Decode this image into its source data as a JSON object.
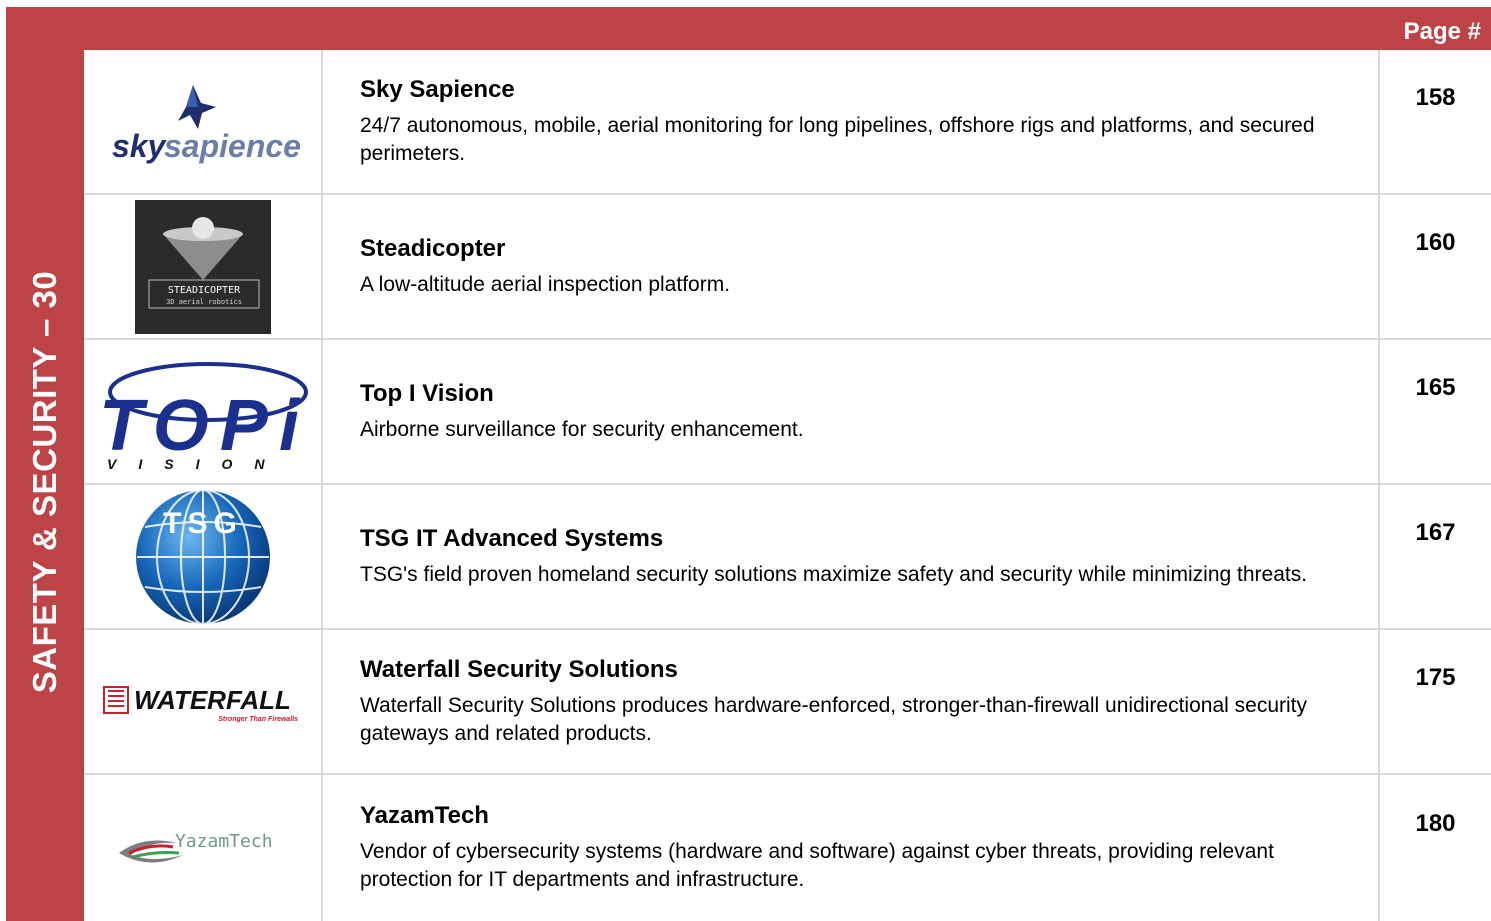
{
  "side_label": "SAFETY & SECURITY – 30",
  "page_header": "Page #",
  "rows": [
    {
      "name": "Sky Sapience",
      "description": "24/7 autonomous, mobile, aerial monitoring for long pipelines, offshore rigs and platforms, and secured perimeters.",
      "page": "158",
      "logo": {
        "icon": "skysapience-logo",
        "text_a": "sky",
        "text_b": "sapience"
      }
    },
    {
      "name": "Steadicopter",
      "description": "A low-altitude aerial inspection platform.",
      "page": "160",
      "logo": {
        "icon": "steadicopter-logo",
        "line1": "STEADICOPTER",
        "line2": "3D aerial robotics"
      }
    },
    {
      "name": "Top I Vision",
      "description": "Airborne surveillance for security enhancement.",
      "page": "165",
      "logo": {
        "icon": "topivision-logo",
        "line1": "TOPi",
        "line2": "VISION"
      }
    },
    {
      "name": "TSG IT Advanced Systems",
      "description": "TSG's field proven homeland security solutions maximize safety and security while minimizing threats.",
      "page": "167",
      "logo": {
        "icon": "tsg-globe-logo",
        "text": "TSG"
      }
    },
    {
      "name": "Waterfall Security Solutions",
      "description": "Waterfall Security Solutions produces hardware-enforced, stronger-than-firewall unidirectional security gateways and related products.",
      "page": "175",
      "logo": {
        "icon": "waterfall-logo",
        "text": "WATERFALL",
        "tagline": "Stronger Than Firewalls"
      }
    },
    {
      "name": "YazamTech",
      "description": "Vendor of cybersecurity systems (hardware and software) against cyber threats, providing relevant protection for IT departments and infrastructure.",
      "page": "180",
      "logo": {
        "icon": "yazamtech-logo",
        "text": "YazamTech"
      }
    }
  ],
  "colors": {
    "accent": "#bd4446",
    "divider": "#d9d9d9"
  }
}
